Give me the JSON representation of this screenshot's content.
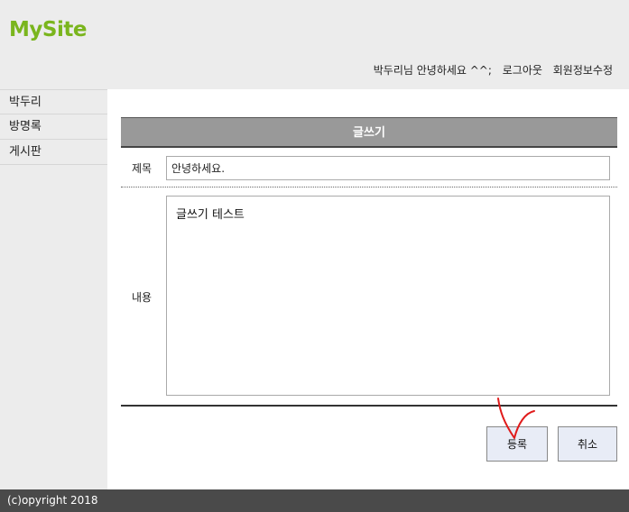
{
  "header": {
    "logo": "MySite",
    "greeting": "박두리님 안녕하세요 ^^;",
    "logout": "로그아웃",
    "edit_profile": "회원정보수정"
  },
  "sidebar": {
    "items": [
      {
        "label": "박두리"
      },
      {
        "label": "방명록"
      },
      {
        "label": "게시판"
      }
    ]
  },
  "form": {
    "heading": "글쓰기",
    "title_label": "제목",
    "title_value": "안녕하세요.",
    "content_label": "내용",
    "content_value": "글쓰기 테스트",
    "submit_label": "등록",
    "cancel_label": "취소"
  },
  "annotation_color": "#e01b1b",
  "footer": {
    "copyright": "(c)opyright 2018"
  }
}
